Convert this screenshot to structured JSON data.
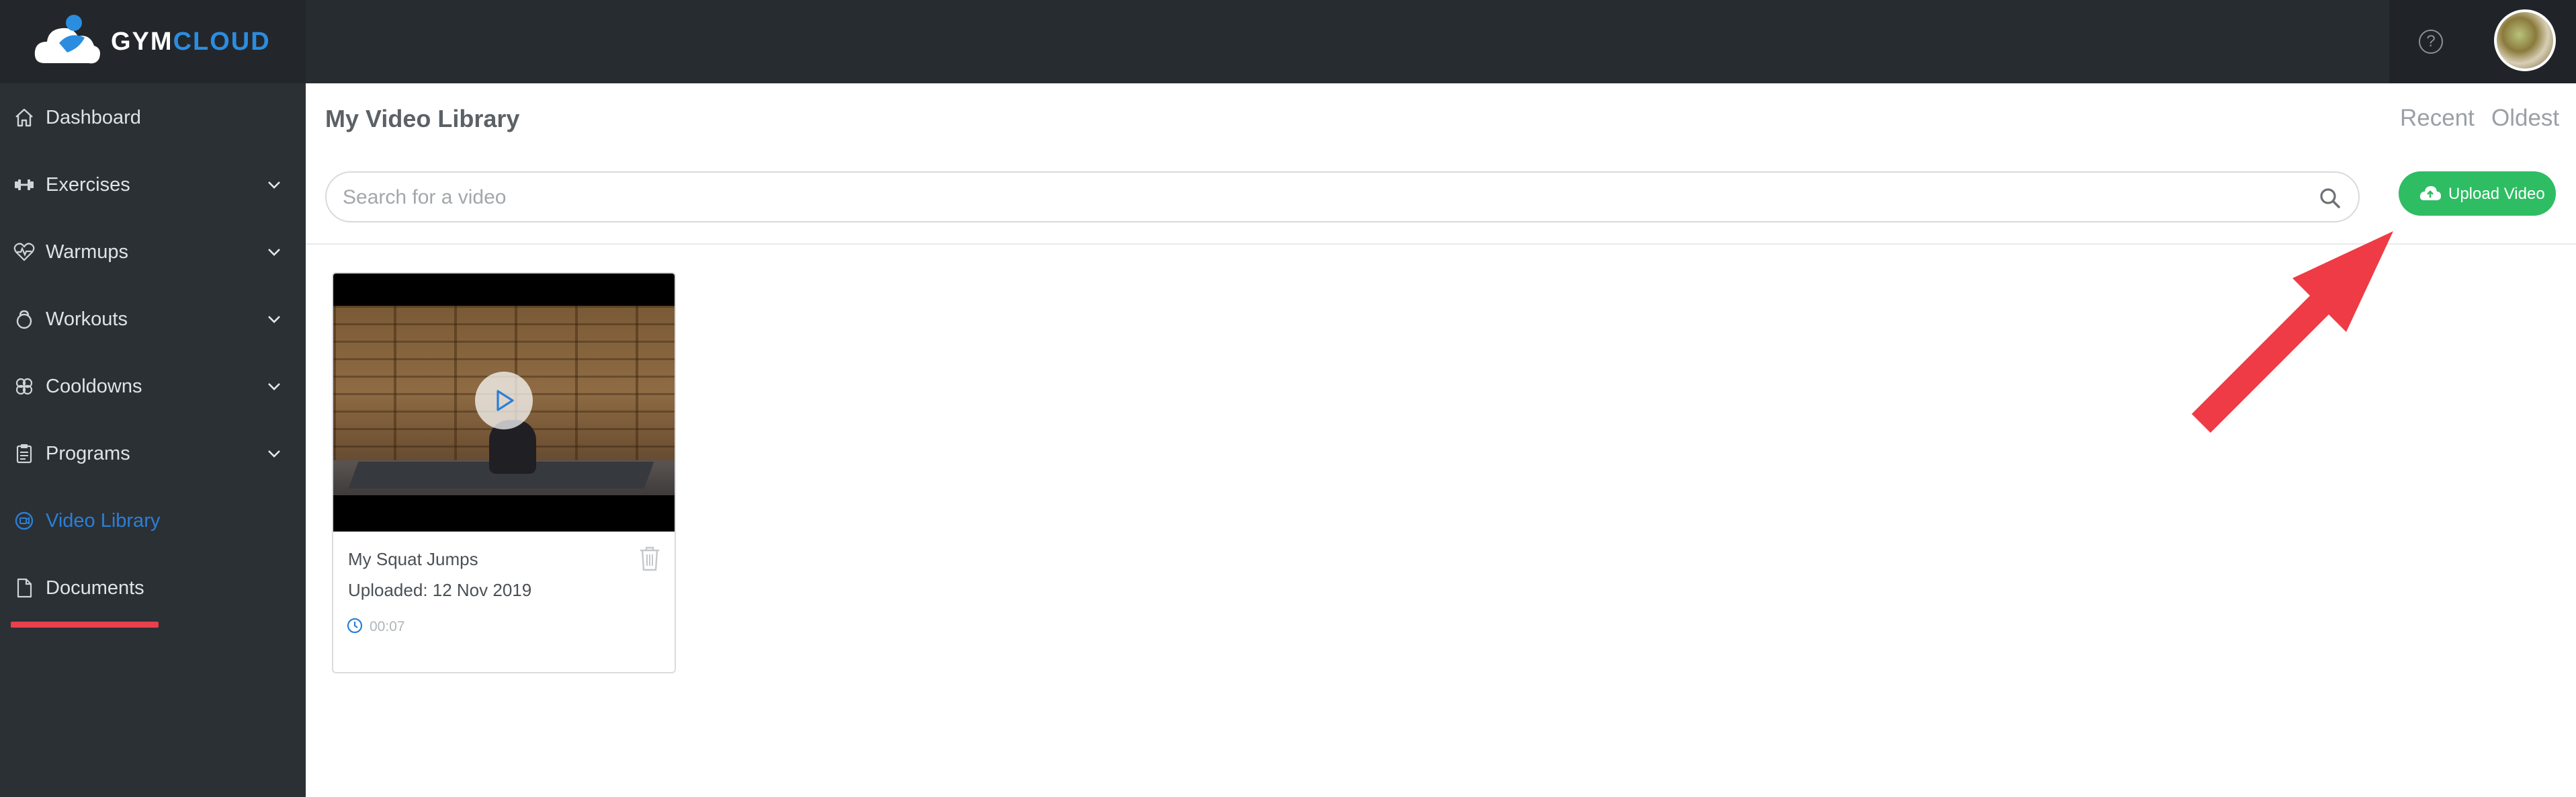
{
  "app": {
    "brand_part1": "GYM",
    "brand_part2": "CLOUD",
    "help_label": "?"
  },
  "sidebar": {
    "items": [
      {
        "label": "Dashboard",
        "icon": "home-icon",
        "has_chevron": false
      },
      {
        "label": "Exercises",
        "icon": "dumbbell-icon",
        "has_chevron": true
      },
      {
        "label": "Warmups",
        "icon": "heartbeat-icon",
        "has_chevron": true
      },
      {
        "label": "Workouts",
        "icon": "kettlebell-icon",
        "has_chevron": true
      },
      {
        "label": "Cooldowns",
        "icon": "flower-icon",
        "has_chevron": true
      },
      {
        "label": "Programs",
        "icon": "clipboard-icon",
        "has_chevron": true
      },
      {
        "label": "Video Library",
        "icon": "video-circle-icon",
        "has_chevron": false,
        "active": true
      },
      {
        "label": "Documents",
        "icon": "document-icon",
        "has_chevron": false
      }
    ]
  },
  "main": {
    "title": "My Video Library",
    "sort_recent": "Recent",
    "sort_oldest": "Oldest",
    "search_placeholder": "Search for a video",
    "search_value": "",
    "upload_label": "Upload Video"
  },
  "videos": [
    {
      "title": "My Squat Jumps",
      "uploaded": "Uploaded: 12 Nov 2019",
      "duration": "00:07"
    }
  ],
  "colors": {
    "topbar": "#272c30",
    "sidebar": "#2b3035",
    "accent_blue": "#2b7fd6",
    "upload_green": "#2ebd63",
    "annotation_red": "#ef3b45"
  }
}
